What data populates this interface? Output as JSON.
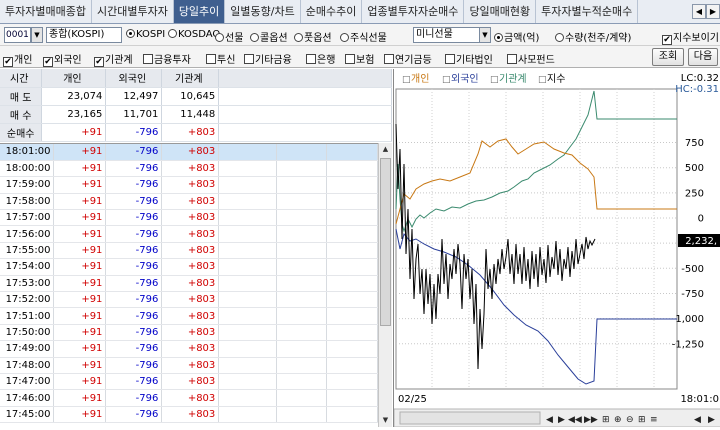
{
  "tabs": [
    "투자자별매매종합",
    "시간대별투자자",
    "당일추이",
    "일별동향/차트",
    "순매수추이",
    "업종별투자자순매수",
    "당일매매현황",
    "투자자별누적순매수"
  ],
  "active_tab": 2,
  "toolbar": {
    "code": "0001",
    "market": "종합(KOSPI)",
    "markets": [
      "KOSPI",
      "KOSDAQ",
      "선물",
      "콜옵션",
      "풋옵션",
      "주식선물"
    ],
    "mini": "미니선물",
    "units": [
      "금액(억)",
      "수량(천주/계약)"
    ],
    "index_toggle": "지수보이기",
    "investors": [
      "개인",
      "외국인",
      "기관계",
      "금융투자",
      "투신",
      "기타금융",
      "은행",
      "보험",
      "연기금등",
      "기타법인",
      "사모펀드"
    ],
    "query_btn": "조회",
    "next_btn": "다음"
  },
  "summary": {
    "headers": [
      "시간",
      "개인",
      "외국인",
      "기관계"
    ],
    "rows": [
      {
        "label": "매 도",
        "v": [
          "23,074",
          "12,497",
          "10,645"
        ]
      },
      {
        "label": "매 수",
        "v": [
          "23,165",
          "11,701",
          "11,448"
        ]
      },
      {
        "label": "순매수",
        "v": [
          "+91",
          "-796",
          "+803"
        ]
      }
    ]
  },
  "grid": {
    "times": [
      "18:01:00",
      "18:00:00",
      "17:59:00",
      "17:58:00",
      "17:57:00",
      "17:56:00",
      "17:55:00",
      "17:54:00",
      "17:53:00",
      "17:52:00",
      "17:51:00",
      "17:50:00",
      "17:49:00",
      "17:48:00",
      "17:47:00",
      "17:46:00",
      "17:45:00"
    ],
    "personal": "+91",
    "foreign": "-796",
    "inst": "+803"
  },
  "chart_data": {
    "type": "line",
    "legend": [
      "개인",
      "외국인",
      "기관계",
      "지수"
    ],
    "date_label": "02/25",
    "time_label": "18:01:0",
    "lc_label": "LC:0.32",
    "hc_label": "HC:-0.31",
    "current_value": "2,232,",
    "y_ticks": [
      "750",
      "500",
      "250",
      "0",
      "-250",
      "-500",
      "-750",
      "-1,000",
      "-1,250"
    ],
    "ylim": [
      -1350,
      1000
    ]
  },
  "colors": {
    "personal": "#c87814",
    "foreign": "#2a3f9a",
    "inst": "#3a8a6e",
    "index": "#000000",
    "active_tab": "#3f5f8f"
  }
}
